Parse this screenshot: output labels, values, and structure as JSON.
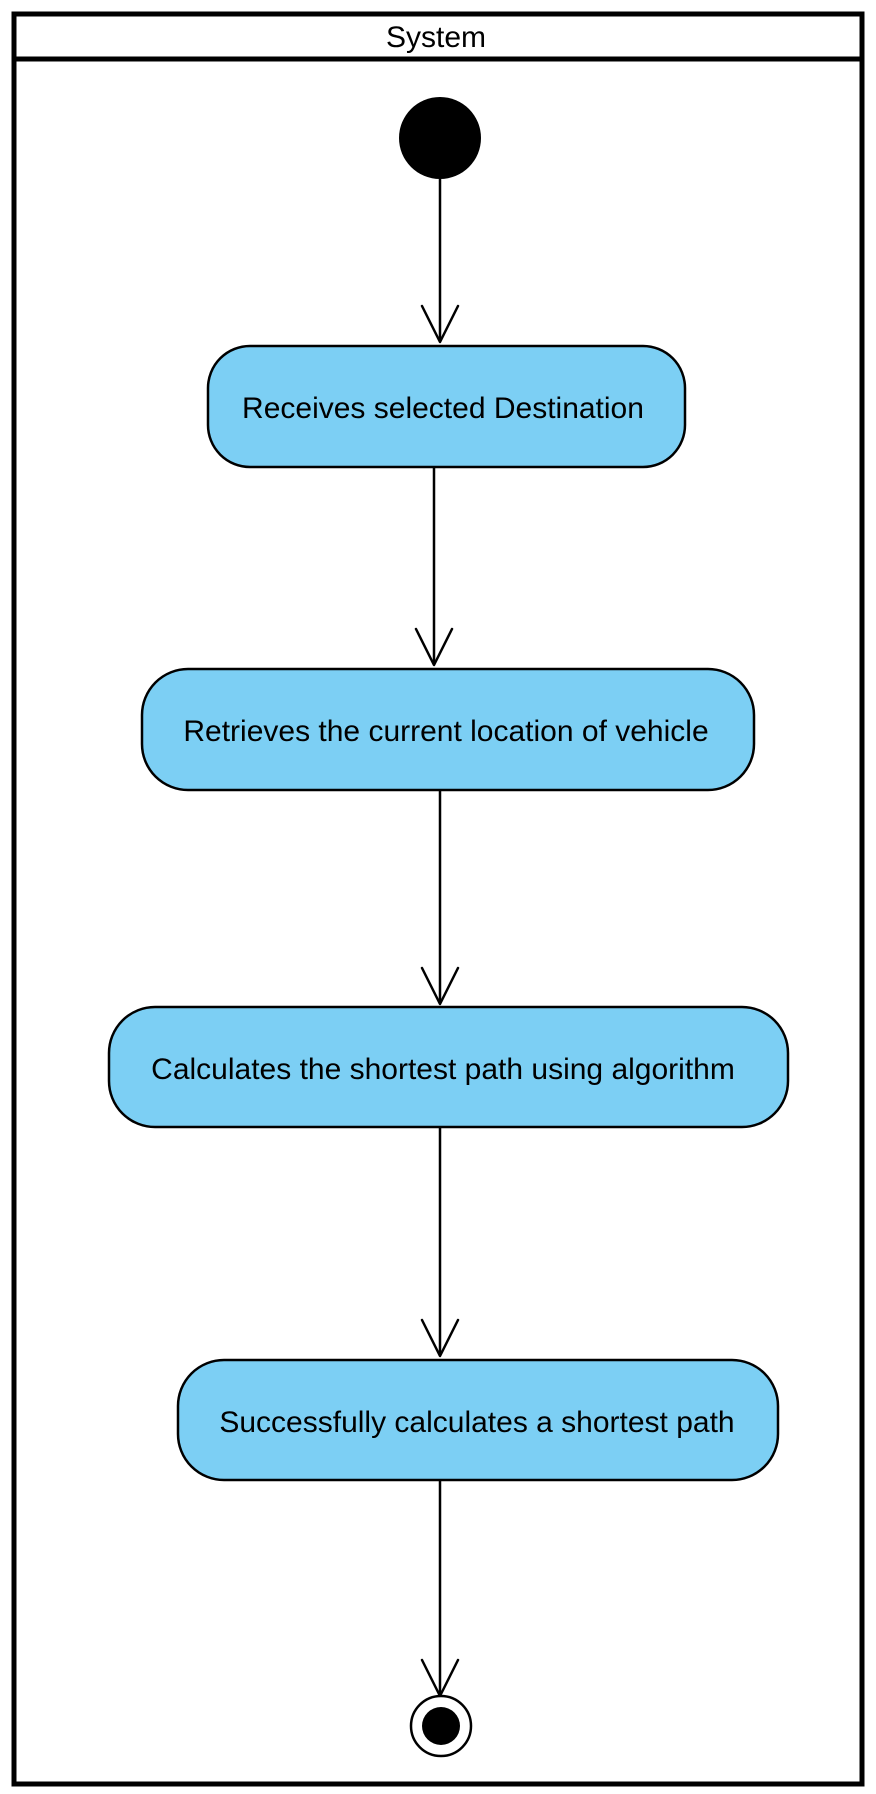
{
  "swimlane": {
    "title": "System"
  },
  "actions": [
    {
      "label": "Receives selected Destination"
    },
    {
      "label": "Retrieves the current location of vehicle"
    },
    {
      "label": "Calculates the shortest path using algorithm"
    },
    {
      "label": "Successfully calculates a shortest path"
    }
  ],
  "nodes": {
    "initial": "initial-node",
    "final": "final-node"
  },
  "colors": {
    "action_fill": "#7ccff4",
    "stroke": "#000000",
    "background": "#ffffff"
  }
}
